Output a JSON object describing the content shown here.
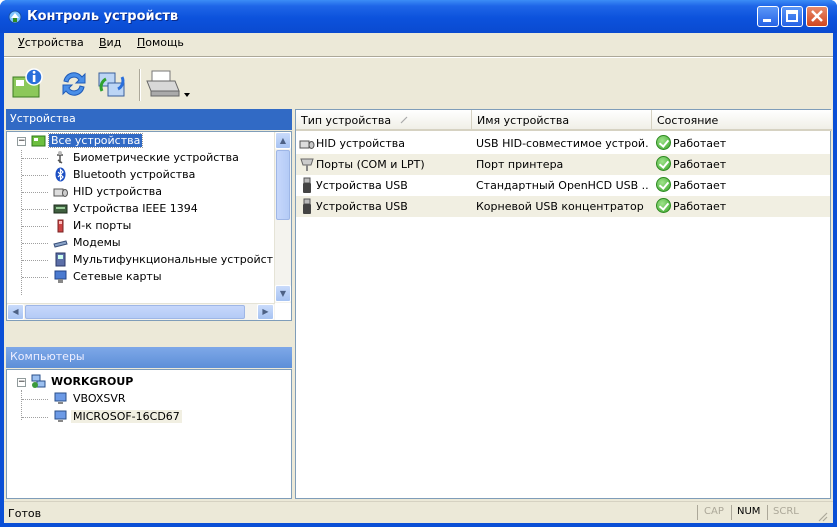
{
  "window": {
    "title": "Контроль устройств"
  },
  "menu": {
    "items": [
      {
        "underline": "У",
        "rest": "стройства"
      },
      {
        "underline": "В",
        "rest": "ид"
      },
      {
        "underline": "П",
        "rest": "омощь"
      }
    ]
  },
  "toolbar": {
    "tools": [
      "properties-icon",
      "refresh-icon",
      "network-connect-icon",
      "printer-icon"
    ]
  },
  "devices_pane": {
    "header": "Устройства",
    "tree": [
      {
        "label": "Все устройства",
        "icon": "all-devices-icon"
      },
      {
        "label": "Биометрические устройства",
        "icon": "biometric-icon"
      },
      {
        "label": "Bluetooth устройства",
        "icon": "bluetooth-icon"
      },
      {
        "label": "HID устройства",
        "icon": "hid-icon"
      },
      {
        "label": "Устройства IEEE 1394",
        "icon": "ieee1394-icon"
      },
      {
        "label": "И-к порты",
        "icon": "infrared-icon"
      },
      {
        "label": "Модемы",
        "icon": "modem-icon"
      },
      {
        "label": "Мультифункциональные устройства",
        "icon": "multifunction-icon"
      },
      {
        "label": "Сетевые карты",
        "icon": "network-card-icon"
      }
    ]
  },
  "computers_pane": {
    "header": "Компьютеры",
    "workgroup": "WORKGROUP",
    "computers": [
      "VBOXSVR",
      "MICROSOF-16CD67"
    ]
  },
  "device_list": {
    "columns": [
      "Тип устройства",
      "Имя устройства",
      "Состояние"
    ],
    "rows": [
      {
        "type": "HID устройства",
        "name": "USB HID-совместимое устрой...",
        "status": "Работает",
        "icon": "hid-icon"
      },
      {
        "type": "Порты (COM и LPT)",
        "name": "Порт принтера",
        "status": "Работает",
        "icon": "port-icon"
      },
      {
        "type": "Устройства USB",
        "name": "Стандартный OpenHCD USB ...",
        "status": "Работает",
        "icon": "usb-icon"
      },
      {
        "type": "Устройства USB",
        "name": "Корневой USB концентратор",
        "status": "Работает",
        "icon": "usb-icon"
      }
    ]
  },
  "statusbar": {
    "text": "Готов",
    "cap": "CAP",
    "num": "NUM",
    "scrl": "SCRL"
  },
  "colors": {
    "title_blue": "#0c52dc",
    "selection": "#316ac5",
    "face": "#ece9d8",
    "ok_green": "#3aa52b"
  }
}
